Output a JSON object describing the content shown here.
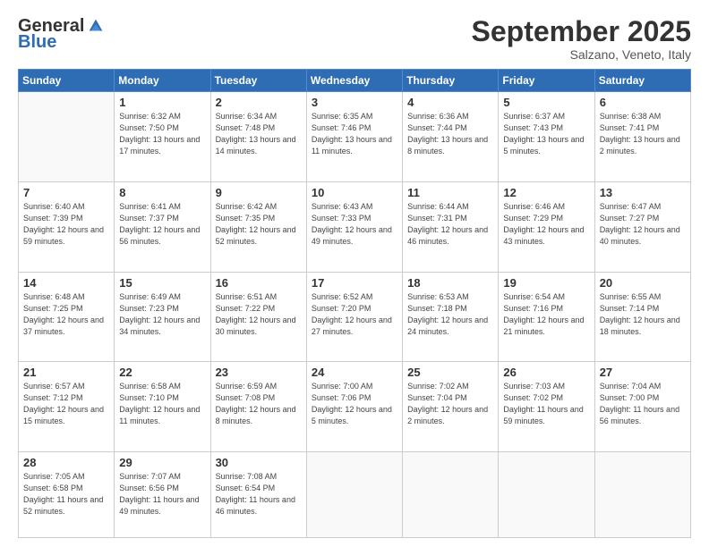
{
  "header": {
    "logo_general": "General",
    "logo_blue": "Blue",
    "month_title": "September 2025",
    "location": "Salzano, Veneto, Italy"
  },
  "days_of_week": [
    "Sunday",
    "Monday",
    "Tuesday",
    "Wednesday",
    "Thursday",
    "Friday",
    "Saturday"
  ],
  "weeks": [
    [
      {
        "day": "",
        "sunrise": "",
        "sunset": "",
        "daylight": ""
      },
      {
        "day": "1",
        "sunrise": "Sunrise: 6:32 AM",
        "sunset": "Sunset: 7:50 PM",
        "daylight": "Daylight: 13 hours and 17 minutes."
      },
      {
        "day": "2",
        "sunrise": "Sunrise: 6:34 AM",
        "sunset": "Sunset: 7:48 PM",
        "daylight": "Daylight: 13 hours and 14 minutes."
      },
      {
        "day": "3",
        "sunrise": "Sunrise: 6:35 AM",
        "sunset": "Sunset: 7:46 PM",
        "daylight": "Daylight: 13 hours and 11 minutes."
      },
      {
        "day": "4",
        "sunrise": "Sunrise: 6:36 AM",
        "sunset": "Sunset: 7:44 PM",
        "daylight": "Daylight: 13 hours and 8 minutes."
      },
      {
        "day": "5",
        "sunrise": "Sunrise: 6:37 AM",
        "sunset": "Sunset: 7:43 PM",
        "daylight": "Daylight: 13 hours and 5 minutes."
      },
      {
        "day": "6",
        "sunrise": "Sunrise: 6:38 AM",
        "sunset": "Sunset: 7:41 PM",
        "daylight": "Daylight: 13 hours and 2 minutes."
      }
    ],
    [
      {
        "day": "7",
        "sunrise": "Sunrise: 6:40 AM",
        "sunset": "Sunset: 7:39 PM",
        "daylight": "Daylight: 12 hours and 59 minutes."
      },
      {
        "day": "8",
        "sunrise": "Sunrise: 6:41 AM",
        "sunset": "Sunset: 7:37 PM",
        "daylight": "Daylight: 12 hours and 56 minutes."
      },
      {
        "day": "9",
        "sunrise": "Sunrise: 6:42 AM",
        "sunset": "Sunset: 7:35 PM",
        "daylight": "Daylight: 12 hours and 52 minutes."
      },
      {
        "day": "10",
        "sunrise": "Sunrise: 6:43 AM",
        "sunset": "Sunset: 7:33 PM",
        "daylight": "Daylight: 12 hours and 49 minutes."
      },
      {
        "day": "11",
        "sunrise": "Sunrise: 6:44 AM",
        "sunset": "Sunset: 7:31 PM",
        "daylight": "Daylight: 12 hours and 46 minutes."
      },
      {
        "day": "12",
        "sunrise": "Sunrise: 6:46 AM",
        "sunset": "Sunset: 7:29 PM",
        "daylight": "Daylight: 12 hours and 43 minutes."
      },
      {
        "day": "13",
        "sunrise": "Sunrise: 6:47 AM",
        "sunset": "Sunset: 7:27 PM",
        "daylight": "Daylight: 12 hours and 40 minutes."
      }
    ],
    [
      {
        "day": "14",
        "sunrise": "Sunrise: 6:48 AM",
        "sunset": "Sunset: 7:25 PM",
        "daylight": "Daylight: 12 hours and 37 minutes."
      },
      {
        "day": "15",
        "sunrise": "Sunrise: 6:49 AM",
        "sunset": "Sunset: 7:23 PM",
        "daylight": "Daylight: 12 hours and 34 minutes."
      },
      {
        "day": "16",
        "sunrise": "Sunrise: 6:51 AM",
        "sunset": "Sunset: 7:22 PM",
        "daylight": "Daylight: 12 hours and 30 minutes."
      },
      {
        "day": "17",
        "sunrise": "Sunrise: 6:52 AM",
        "sunset": "Sunset: 7:20 PM",
        "daylight": "Daylight: 12 hours and 27 minutes."
      },
      {
        "day": "18",
        "sunrise": "Sunrise: 6:53 AM",
        "sunset": "Sunset: 7:18 PM",
        "daylight": "Daylight: 12 hours and 24 minutes."
      },
      {
        "day": "19",
        "sunrise": "Sunrise: 6:54 AM",
        "sunset": "Sunset: 7:16 PM",
        "daylight": "Daylight: 12 hours and 21 minutes."
      },
      {
        "day": "20",
        "sunrise": "Sunrise: 6:55 AM",
        "sunset": "Sunset: 7:14 PM",
        "daylight": "Daylight: 12 hours and 18 minutes."
      }
    ],
    [
      {
        "day": "21",
        "sunrise": "Sunrise: 6:57 AM",
        "sunset": "Sunset: 7:12 PM",
        "daylight": "Daylight: 12 hours and 15 minutes."
      },
      {
        "day": "22",
        "sunrise": "Sunrise: 6:58 AM",
        "sunset": "Sunset: 7:10 PM",
        "daylight": "Daylight: 12 hours and 11 minutes."
      },
      {
        "day": "23",
        "sunrise": "Sunrise: 6:59 AM",
        "sunset": "Sunset: 7:08 PM",
        "daylight": "Daylight: 12 hours and 8 minutes."
      },
      {
        "day": "24",
        "sunrise": "Sunrise: 7:00 AM",
        "sunset": "Sunset: 7:06 PM",
        "daylight": "Daylight: 12 hours and 5 minutes."
      },
      {
        "day": "25",
        "sunrise": "Sunrise: 7:02 AM",
        "sunset": "Sunset: 7:04 PM",
        "daylight": "Daylight: 12 hours and 2 minutes."
      },
      {
        "day": "26",
        "sunrise": "Sunrise: 7:03 AM",
        "sunset": "Sunset: 7:02 PM",
        "daylight": "Daylight: 11 hours and 59 minutes."
      },
      {
        "day": "27",
        "sunrise": "Sunrise: 7:04 AM",
        "sunset": "Sunset: 7:00 PM",
        "daylight": "Daylight: 11 hours and 56 minutes."
      }
    ],
    [
      {
        "day": "28",
        "sunrise": "Sunrise: 7:05 AM",
        "sunset": "Sunset: 6:58 PM",
        "daylight": "Daylight: 11 hours and 52 minutes."
      },
      {
        "day": "29",
        "sunrise": "Sunrise: 7:07 AM",
        "sunset": "Sunset: 6:56 PM",
        "daylight": "Daylight: 11 hours and 49 minutes."
      },
      {
        "day": "30",
        "sunrise": "Sunrise: 7:08 AM",
        "sunset": "Sunset: 6:54 PM",
        "daylight": "Daylight: 11 hours and 46 minutes."
      },
      {
        "day": "",
        "sunrise": "",
        "sunset": "",
        "daylight": ""
      },
      {
        "day": "",
        "sunrise": "",
        "sunset": "",
        "daylight": ""
      },
      {
        "day": "",
        "sunrise": "",
        "sunset": "",
        "daylight": ""
      },
      {
        "day": "",
        "sunrise": "",
        "sunset": "",
        "daylight": ""
      }
    ]
  ]
}
